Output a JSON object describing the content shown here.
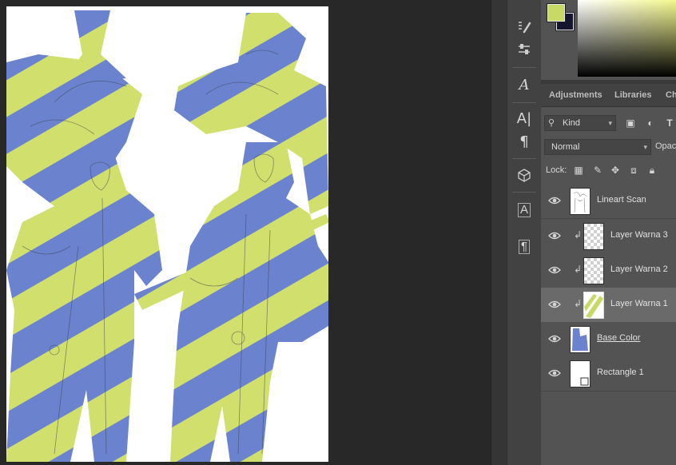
{
  "panels": {
    "tabs": [
      "Adjustments",
      "Libraries",
      "Ch"
    ]
  },
  "layer_options": {
    "filter_kind": "Kind",
    "blend_mode": "Normal",
    "opacity_label": "Opac",
    "lock_label": "Lock:"
  },
  "layers": [
    {
      "name": "Lineart Scan",
      "visible": true,
      "clipped": false,
      "selected": false
    },
    {
      "name": "Layer Warna 3",
      "visible": true,
      "clipped": true,
      "selected": false
    },
    {
      "name": "Layer Warna 2",
      "visible": true,
      "clipped": true,
      "selected": false
    },
    {
      "name": "Layer Warna 1",
      "visible": true,
      "clipped": true,
      "selected": true
    },
    {
      "name": "Base Color",
      "visible": true,
      "clipped": false,
      "selected": false
    },
    {
      "name": "Rectangle 1",
      "visible": true,
      "clipped": false,
      "selected": false
    }
  ],
  "colors": {
    "foreground": "#c9d966",
    "background": "#15152e",
    "base_color": "#6b83cf",
    "stripe_color": "#d1df6c"
  },
  "tools": [
    "brush-settings-icon",
    "adjust-sliders-icon",
    "character-style-icon",
    "character-icon",
    "paragraph-icon",
    "3d-cube-icon",
    "character-styles-icon",
    "paragraph-styles-icon"
  ]
}
